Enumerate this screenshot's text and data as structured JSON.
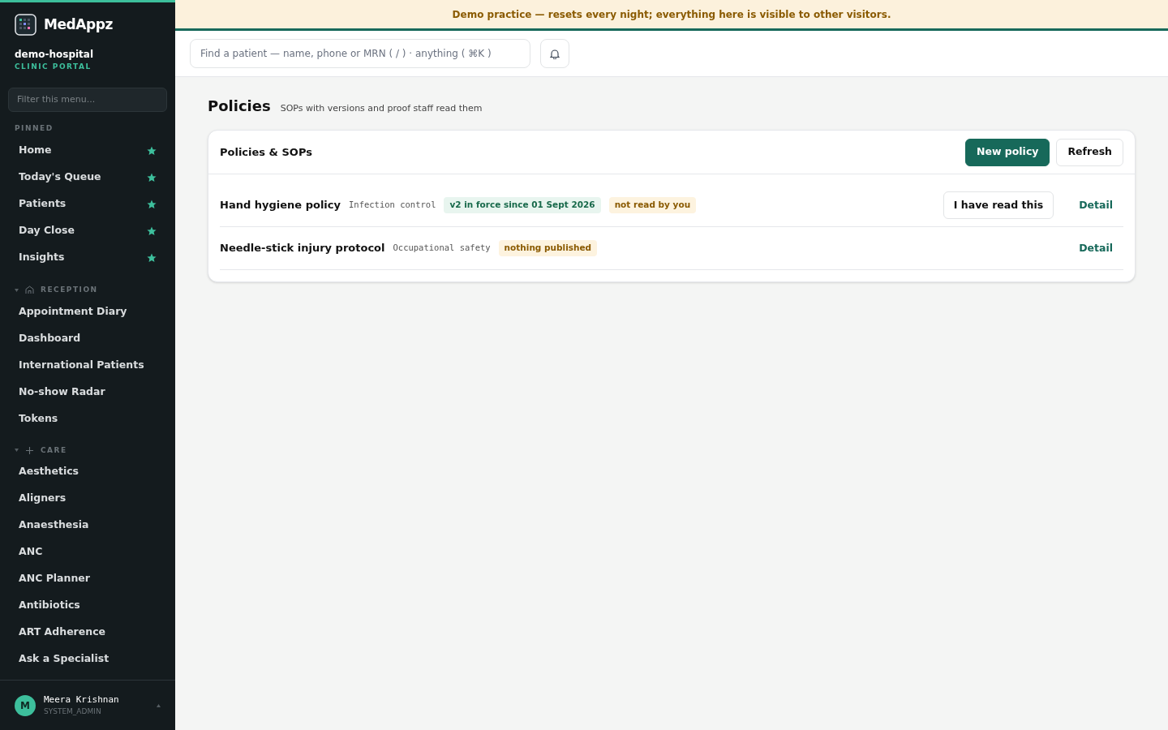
{
  "brand": {
    "name": "MedAppz",
    "org": "demo-hospital",
    "portal": "CLINIC PORTAL"
  },
  "sidebar": {
    "filter_placeholder": "Filter this menu...",
    "pinned": {
      "title": "PINNED",
      "items": [
        {
          "label": "Home",
          "starred": true
        },
        {
          "label": "Today's Queue",
          "starred": true
        },
        {
          "label": "Patients",
          "starred": true
        },
        {
          "label": "Day Close",
          "starred": true
        },
        {
          "label": "Insights",
          "starred": true
        }
      ]
    },
    "sections": [
      {
        "title": "RECEPTION",
        "kind": "home",
        "expanded": true,
        "items": [
          "Appointment Diary",
          "Dashboard",
          "International Patients",
          "No-show Radar",
          "Tokens"
        ]
      },
      {
        "title": "CARE",
        "kind": "plus",
        "expanded": true,
        "items": [
          "Aesthetics",
          "Aligners",
          "Anaesthesia",
          "ANC",
          "ANC Planner",
          "Antibiotics",
          "ART Adherence",
          "Ask a Specialist"
        ]
      }
    ],
    "user": {
      "initial": "M",
      "name": "Meera Krishnan",
      "role": "SYSTEM_ADMIN"
    }
  },
  "banner": "Demo practice — resets every night; everything here is visible to other visitors.",
  "search": {
    "placeholder": "Find a patient — name, phone or MRN ( / ) · anything ( ⌘K )"
  },
  "page": {
    "title": "Policies",
    "subtitle": "SOPs with versions and proof staff read them"
  },
  "card": {
    "title": "Policies & SOPs",
    "buttons": [
      {
        "label": "New policy",
        "kind": "primary"
      },
      {
        "label": "Refresh",
        "kind": "secondary"
      }
    ],
    "rows": [
      {
        "title": "Hand hygiene policy",
        "category": "Infection control",
        "badges": [
          {
            "text": "v2 in force since 01 Sept 2026",
            "kind": "success"
          },
          {
            "text": "not read by you",
            "kind": "warning"
          }
        ],
        "read_button": "I have read this",
        "link": "Detail"
      },
      {
        "title": "Needle-stick injury protocol",
        "category": "Occupational safety",
        "badges": [
          {
            "text": "nothing published",
            "kind": "warning"
          }
        ],
        "link": "Detail"
      }
    ]
  }
}
